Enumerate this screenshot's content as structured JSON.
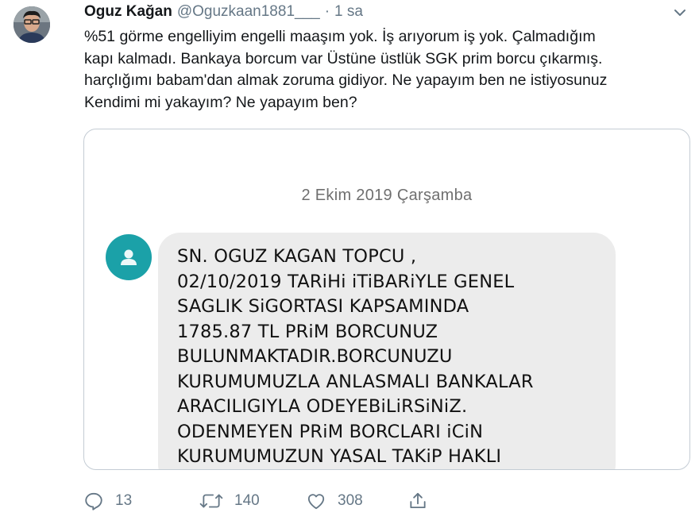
{
  "tweet": {
    "author_name": "Oguz Kağan",
    "author_handle": "@Oguzkaan1881___",
    "separator": "·",
    "time": "1 sa",
    "text": "%51 görme engelliyim engelli maaşım yok. İş arıyorum iş yok. Çalmadığım\nkapı kalmadı. Bankaya borcum var Üstüne üstlük SGK prim borcu çıkarmış.\nharçlığımı babam'dan almak zoruma gidiyor. Ne yapayım ben ne istiyosunuz\nKendimi mi yakayım? Ne yapayım ben?"
  },
  "media": {
    "date": "2 Ekim 2019 Çarşamba",
    "message": "SN. OGUZ KAGAN TOPCU ,\n02/10/2019 TARiHi iTiBARiYLE GENEL\nSAGLIK SiGORTASI KAPSAMINDA\n1785.87 TL PRiM BORCUNUZ\nBULUNMAKTADIR.BORCUNUZU\nKURUMUMUZLA ANLASMALI BANKALAR\nARACILIGIYLA ODEYEBiLiRSiNiZ.\nODENMEYEN PRiM BORCLARI iCiN\nKURUMUMUZUN YASAL TAKiP HAKLI"
  },
  "actions": {
    "replies": "13",
    "retweets": "140",
    "likes": "308"
  },
  "icons": {
    "reply": "reply-icon",
    "retweet": "retweet-icon",
    "like": "heart-icon",
    "share": "share-icon",
    "menu": "chevron-down-icon",
    "contact": "person-icon"
  },
  "colors": {
    "secondary_text": "#657786",
    "contact_avatar": "#1ba1a8",
    "bubble": "#ececec"
  }
}
